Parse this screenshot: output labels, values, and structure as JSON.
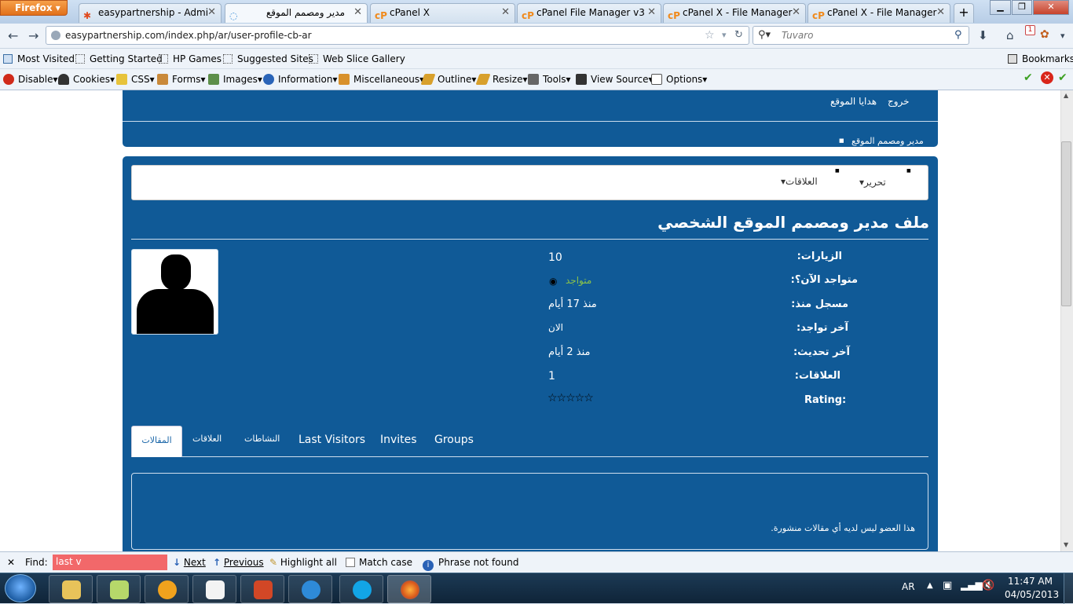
{
  "browser": {
    "app_button": "Firefox",
    "tabs": [
      {
        "label": "easypartnership - Admini...",
        "icon": "joomla-icon"
      },
      {
        "label": "مدير ومصمم الموقع",
        "icon": "loading-icon"
      },
      {
        "label": "cPanel X",
        "icon": "cpanel-icon"
      },
      {
        "label": "cPanel File Manager v3",
        "icon": "cpanel-icon"
      },
      {
        "label": "cPanel X - File Manager",
        "icon": "cpanel-icon"
      },
      {
        "label": "cPanel X - File Manager",
        "icon": "cpanel-icon"
      }
    ],
    "url": "easypartnership.com/index.php/ar/user-profile-cb-ar",
    "search_placeholder": "Tuvaro",
    "notification_count": "1",
    "bookmarks": [
      "Most Visited",
      "Getting Started",
      "HP Games",
      "Suggested Sites",
      "Web Slice Gallery"
    ],
    "bookmarks_menu": "Bookmarks",
    "devbar": [
      "Disable▾",
      "Cookies▾",
      "CSS▾",
      "Forms▾",
      "Images▾",
      "Information▾",
      "Miscellaneous▾",
      "Outline▾",
      "Resize▾",
      "Tools▾",
      "View Source▾",
      "Options▾"
    ]
  },
  "site": {
    "top_menu": {
      "logout": "خروج",
      "gifts": "هدايا الموقع"
    },
    "breadcrumb": "مدير ومصمم الموقع",
    "profile_menu": {
      "edit": "تحرير",
      "connections": "العلاقات"
    },
    "title": "ملف مدير ومصمم الموقع الشخصي",
    "fields": [
      {
        "label": "الزيارات:",
        "value": "10"
      },
      {
        "label": "متواجد الآن؟:",
        "value": "متواجد"
      },
      {
        "label": "مسجل منذ:",
        "value": "منذ 17 أيام"
      },
      {
        "label": "آخر تواجد:",
        "value": "الان"
      },
      {
        "label": "آخر تحديث:",
        "value": "منذ 2 أيام"
      },
      {
        "label": "العلاقات:",
        "value": "1"
      },
      {
        "label": "Rating:",
        "value": "☆☆☆☆☆"
      }
    ],
    "tabs": [
      "المقالات",
      "العلاقات",
      "النشاطات",
      "Last Visitors",
      "Invites",
      "Groups"
    ],
    "articles_empty": "هذا العضو ليس لديه أي مقالات منشورة."
  },
  "findbar": {
    "label": "Find:",
    "value": "last v",
    "next": "Next",
    "previous": "Previous",
    "highlight": "Highlight all",
    "match_case": "Match case",
    "status": "Phrase not found"
  },
  "taskbar": {
    "lang": "AR",
    "time": "11:47 AM",
    "date": "04/05/2013"
  }
}
